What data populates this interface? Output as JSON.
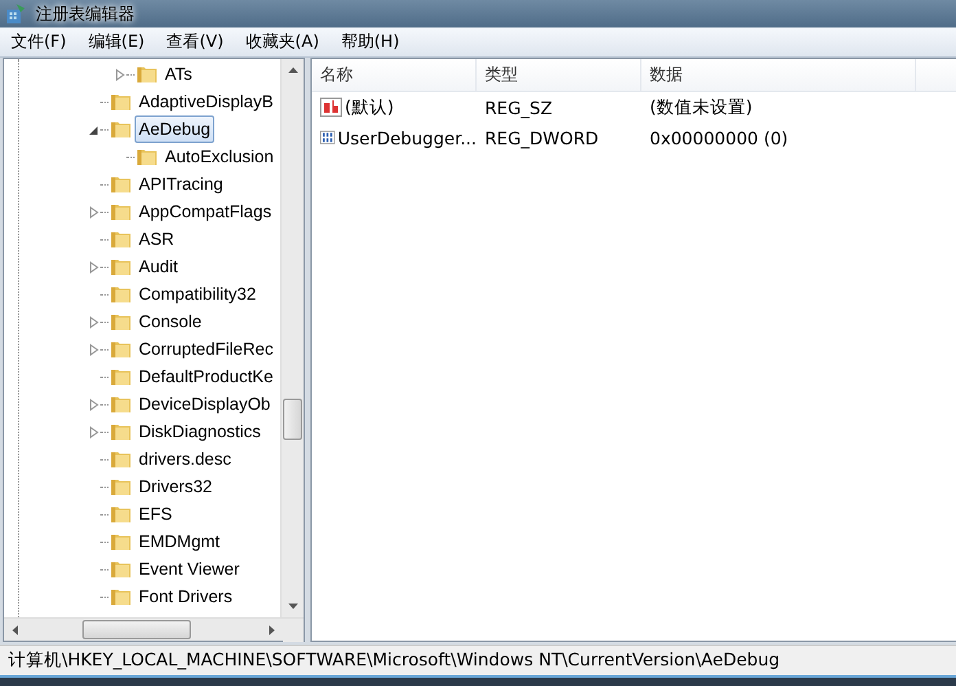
{
  "window": {
    "title": "注册表编辑器"
  },
  "menu": [
    "文件(F)",
    "编辑(E)",
    "查看(V)",
    "收藏夹(A)",
    "帮助(H)"
  ],
  "tree": [
    {
      "children": [
        {
          "label": "ATs",
          "expandable": true,
          "expanded": false,
          "selected": false
        }
      ]
    },
    {
      "label": "AdaptiveDisplayB",
      "expandable": false,
      "selected": false
    },
    {
      "label": "AeDebug",
      "expandable": true,
      "expanded": true,
      "selected": true,
      "children": [
        {
          "label": "AutoExclusion",
          "expandable": false,
          "selected": false
        }
      ]
    },
    {
      "label": "APITracing",
      "expandable": false,
      "selected": false
    },
    {
      "label": "AppCompatFlags",
      "expandable": true,
      "expanded": false,
      "selected": false
    },
    {
      "label": "ASR",
      "expandable": false,
      "selected": false
    },
    {
      "label": "Audit",
      "expandable": true,
      "expanded": false,
      "selected": false
    },
    {
      "label": "Compatibility32",
      "expandable": false,
      "selected": false
    },
    {
      "label": "Console",
      "expandable": true,
      "expanded": false,
      "selected": false
    },
    {
      "label": "CorruptedFileRec",
      "expandable": true,
      "expanded": false,
      "selected": false
    },
    {
      "label": "DefaultProductKe",
      "expandable": false,
      "selected": false
    },
    {
      "label": "DeviceDisplayOb",
      "expandable": true,
      "expanded": false,
      "selected": false
    },
    {
      "label": "DiskDiagnostics",
      "expandable": true,
      "expanded": false,
      "selected": false
    },
    {
      "label": "drivers.desc",
      "expandable": false,
      "selected": false
    },
    {
      "label": "Drivers32",
      "expandable": false,
      "selected": false
    },
    {
      "label": "EFS",
      "expandable": false,
      "selected": false
    },
    {
      "label": "EMDMgmt",
      "expandable": false,
      "selected": false
    },
    {
      "label": "Event Viewer",
      "expandable": false,
      "selected": false
    },
    {
      "label": "Font Drivers",
      "expandable": false,
      "selected": false
    }
  ],
  "values": {
    "columns": [
      "名称",
      "类型",
      "数据"
    ],
    "rows": [
      {
        "kind": "string",
        "name": "(默认)",
        "type": "REG_SZ",
        "data": "(数值未设置)"
      },
      {
        "kind": "binary",
        "name": "UserDebugger...",
        "type": "REG_DWORD",
        "data": "0x00000000 (0)"
      }
    ]
  },
  "status_bar": "计算机\\HKEY_LOCAL_MACHINE\\SOFTWARE\\Microsoft\\Windows NT\\CurrentVersion\\AeDebug"
}
